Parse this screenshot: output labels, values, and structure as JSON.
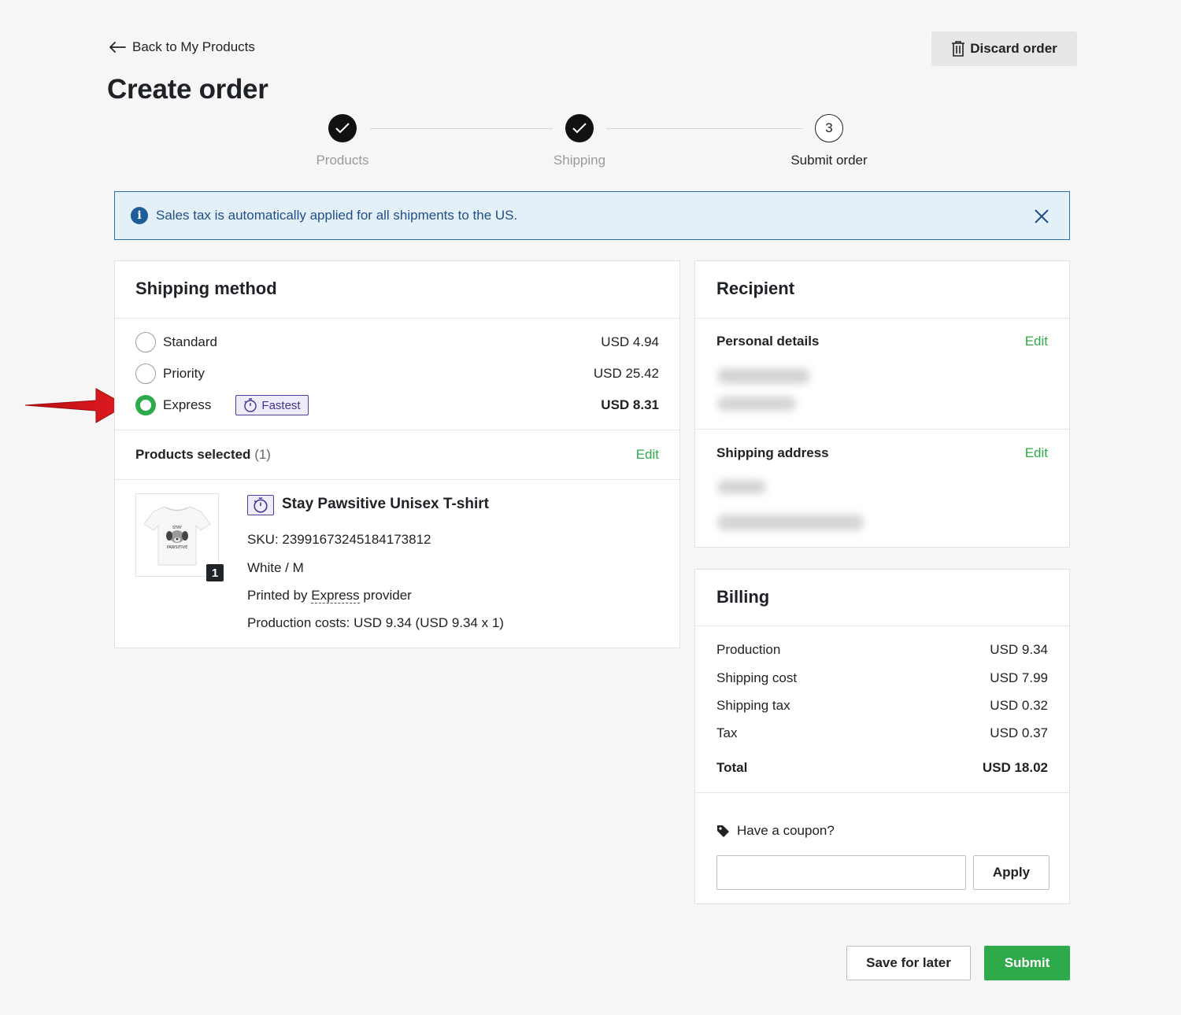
{
  "header": {
    "back_label": "Back to My Products",
    "title": "Create order",
    "discard_label": "Discard order"
  },
  "stepper": {
    "steps": [
      {
        "label": "Products",
        "state": "done"
      },
      {
        "label": "Shipping",
        "state": "done"
      },
      {
        "label": "Submit order",
        "state": "current",
        "number": "3"
      }
    ]
  },
  "banner": {
    "text": "Sales tax is automatically applied for all shipments to the US.",
    "icon": "info-icon"
  },
  "shipping_method": {
    "title": "Shipping method",
    "options": [
      {
        "label": "Standard",
        "price": "USD 4.94",
        "selected": false
      },
      {
        "label": "Priority",
        "price": "USD 25.42",
        "selected": false
      },
      {
        "label": "Express",
        "price": "USD 8.31",
        "selected": true,
        "badge": "Fastest"
      }
    ]
  },
  "products_selected": {
    "label": "Products selected",
    "count": "(1)",
    "edit_label": "Edit",
    "product": {
      "title": "Stay Pawsitive Unisex T-shirt",
      "sku": "SKU: 23991673245184173812",
      "variant": "White / M",
      "printed_by_prefix": "Printed by ",
      "printed_by_provider": "Express",
      "printed_by_suffix": " provider",
      "production_costs": "Production costs: USD 9.34 (USD 9.34 x 1)",
      "quantity": "1",
      "shirt_text_top": "STAY",
      "shirt_text_bottom": "PAWSITIVE"
    }
  },
  "recipient": {
    "title": "Recipient",
    "personal_details_label": "Personal details",
    "shipping_address_label": "Shipping address",
    "edit_label": "Edit"
  },
  "billing": {
    "title": "Billing",
    "rows": [
      {
        "label": "Production",
        "value": "USD 9.34"
      },
      {
        "label": "Shipping cost",
        "value": "USD 7.99"
      },
      {
        "label": "Shipping tax",
        "value": "USD 0.32"
      },
      {
        "label": "Tax",
        "value": "USD 0.37"
      }
    ],
    "total_label": "Total",
    "total_value": "USD 18.02",
    "coupon_label": "Have a coupon?",
    "coupon_value": "",
    "apply_label": "Apply"
  },
  "footer": {
    "save_label": "Save for later",
    "submit_label": "Submit"
  },
  "colors": {
    "accent_green": "#2eaa4a",
    "banner_bg": "#e4f0f8",
    "banner_border": "#2d6fa8",
    "badge_purple": "#4a3fa0",
    "annotation_arrow": "#d9161c"
  }
}
